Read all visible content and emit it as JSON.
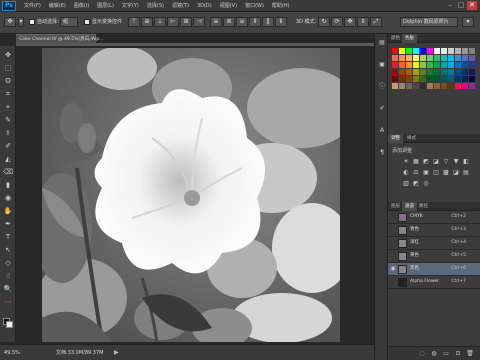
{
  "app": {
    "logo": "Ps"
  },
  "menubar": {
    "items": [
      "文件(F)",
      "编辑(E)",
      "图像(I)",
      "图层(L)",
      "文字(Y)",
      "选择(S)",
      "滤镜(T)",
      "3D(D)",
      "视图(V)",
      "窗口(W)",
      "帮助(H)"
    ],
    "minimize": "–",
    "maximize": "□",
    "close": "✕"
  },
  "optionsbar": {
    "auto_select_label": "自动选择：",
    "auto_select_value": "组",
    "show_transform_label": "显示变换控件",
    "mode_3d_label": "3D 模式：",
    "workspace_value": "Dolphin 数码原照片"
  },
  "document": {
    "tab_label": "Color Channel.tif @ 49.5%(黑白, Alp...",
    "close": "×"
  },
  "status": {
    "zoom": "49.5%",
    "doc_size": "文档:33.0M/89.37M",
    "arrow": "▶"
  },
  "swatches_panel": {
    "tabs": [
      "颜色",
      "色板"
    ],
    "colors": [
      "#ff0000",
      "#ffff00",
      "#00ff00",
      "#00ffff",
      "#0000ff",
      "#ff00ff",
      "#ffffff",
      "#e6e6e6",
      "#cccccc",
      "#b3b3b3",
      "#999999",
      "#808080",
      "#f26c4f",
      "#f68e55",
      "#fbaf5c",
      "#fff467",
      "#acd372",
      "#7cc576",
      "#3bb878",
      "#1abbb4",
      "#00bff3",
      "#438ccb",
      "#5574b9",
      "#605ca8",
      "#ed1c24",
      "#f26522",
      "#f7941d",
      "#fff200",
      "#8dc73f",
      "#39b54a",
      "#00a651",
      "#00a99d",
      "#00aeef",
      "#0072bc",
      "#0054a6",
      "#2e3192",
      "#9e0b0f",
      "#a0410d",
      "#a3620a",
      "#aba000",
      "#598527",
      "#1a7b30",
      "#007236",
      "#00746b",
      "#0076a3",
      "#004b80",
      "#003471",
      "#1b1464",
      "#790000",
      "#7b2e00",
      "#7d4900",
      "#827b00",
      "#406618",
      "#005e20",
      "#005826",
      "#005952",
      "#005b7f",
      "#003663",
      "#002157",
      "#0d004c",
      "#c69c6d",
      "#998675",
      "#736357",
      "#534741",
      "#37302a",
      "#a67c52",
      "#8c6239",
      "#754c24",
      "#603913",
      "#ed145b",
      "#ec008c",
      "#92278f"
    ]
  },
  "adjustments_panel": {
    "tabs": [
      "调整",
      "样式"
    ],
    "title": "添加调整",
    "icons": [
      "☀",
      "▦",
      "◩",
      "◪",
      "▽",
      "▼",
      "◧",
      "◐",
      "⚖",
      "▣",
      "◫",
      "▩",
      "◪",
      "▤",
      "▥",
      "◩",
      "◎"
    ]
  },
  "channels_panel": {
    "tabs": [
      "图层",
      "通道",
      "路径"
    ],
    "active_tab": "通道",
    "channels": [
      {
        "name": "CMYK",
        "shortcut": "Ctrl+2",
        "visible": false,
        "selected": false
      },
      {
        "name": "青色",
        "shortcut": "Ctrl+3",
        "visible": false,
        "selected": false
      },
      {
        "name": "洋红",
        "shortcut": "Ctrl+4",
        "visible": false,
        "selected": false
      },
      {
        "name": "黄色",
        "shortcut": "Ctrl+5",
        "visible": false,
        "selected": false
      },
      {
        "name": "黑色",
        "shortcut": "Ctrl+6",
        "visible": true,
        "selected": true
      },
      {
        "name": "Alpha Flower",
        "shortcut": "Ctrl+7",
        "visible": false,
        "selected": false
      }
    ],
    "footer_icons": [
      "◌",
      "◍",
      "▭",
      "⊡",
      "🗑"
    ]
  },
  "tools": [
    "✥",
    "⬚",
    "ʘ",
    "⌗",
    "⌖",
    "✎",
    "⚕",
    "✐",
    "◭",
    "⌫",
    "▮",
    "◉",
    "✋",
    "✒",
    "T",
    "↖",
    "◇",
    "☝",
    "🔍",
    "⋯"
  ]
}
